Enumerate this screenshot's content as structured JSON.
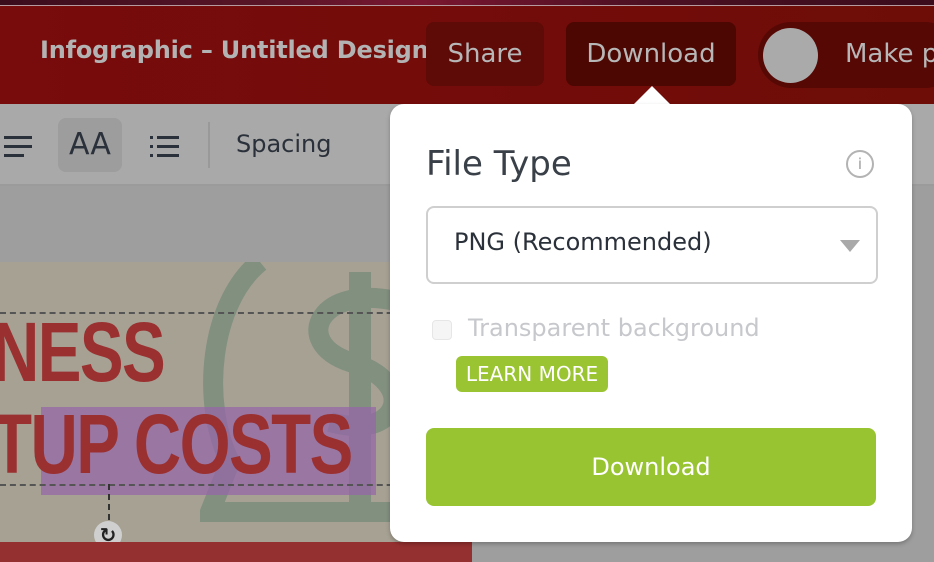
{
  "header": {
    "title": "Infographic – Untitled Design",
    "share_label": "Share",
    "download_label": "Download",
    "make_public_label": "Make pu"
  },
  "toolbar": {
    "align_icon": "align-left-icon",
    "font_size_label": "AA",
    "list_icon": "bullet-list-icon",
    "spacing_label": "Spacing"
  },
  "design": {
    "headline_line1": "NESS",
    "headline_line2": "TUP COSTS",
    "rotate_icon": "rotate-icon"
  },
  "download_panel": {
    "file_type_label": "File Type",
    "info_icon": "info-icon",
    "file_type_value": "PNG (Recommended)",
    "transparent_bg_label": "Transparent background",
    "transparent_bg_checked": false,
    "learn_more_label": "LEARN MORE",
    "download_button_label": "Download"
  },
  "colors": {
    "header_bg": "#780b0c",
    "accent_green": "#98c432",
    "headline_red": "#9a3030"
  }
}
